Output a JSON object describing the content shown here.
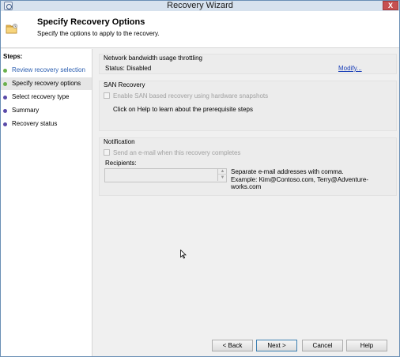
{
  "window": {
    "title": "Recovery Wizard",
    "close_glyph": "X"
  },
  "header": {
    "title": "Specify Recovery Options",
    "subtitle": "Specify the options to apply to the recovery."
  },
  "sidebar": {
    "heading": "Steps:",
    "steps": [
      {
        "label": "Review recovery selection",
        "state": "done"
      },
      {
        "label": "Specify recovery options",
        "state": "current"
      },
      {
        "label": "Select recovery type",
        "state": "pending"
      },
      {
        "label": "Summary",
        "state": "pending"
      },
      {
        "label": "Recovery status",
        "state": "pending"
      }
    ]
  },
  "throttling": {
    "title": "Network bandwidth usage throttling",
    "status": "Status: Disabled",
    "modify_link": "Modify..."
  },
  "san": {
    "title": "SAN Recovery",
    "checkbox_label": "Enable SAN based recovery using hardware snapshots",
    "checked": false,
    "help_text": "Click on Help to learn about the prerequisite steps"
  },
  "notification": {
    "title": "Notification",
    "checkbox_label": "Send an e-mail when this recovery completes",
    "checked": false,
    "recipients_label": "Recipients:",
    "recipients_value": "",
    "hint_line1": "Separate e-mail addresses with comma.",
    "hint_line2": "Example: Kim@Contoso.com, Terry@Adventure-works.com"
  },
  "footer": {
    "back": "< Back",
    "next": "Next >",
    "cancel": "Cancel",
    "help": "Help"
  },
  "colors": {
    "link": "#1a3fb8",
    "step_done_dot": "#6ab04c",
    "step_pending_dot": "#5a4aa8",
    "close_button": "#c75050"
  }
}
